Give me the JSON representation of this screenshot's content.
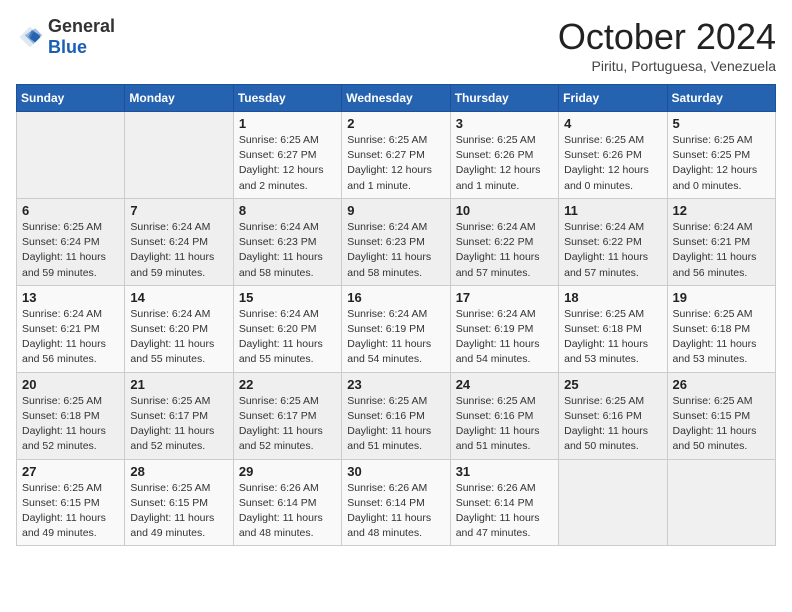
{
  "header": {
    "logo_general": "General",
    "logo_blue": "Blue",
    "month_title": "October 2024",
    "location": "Piritu, Portuguesa, Venezuela"
  },
  "weekdays": [
    "Sunday",
    "Monday",
    "Tuesday",
    "Wednesday",
    "Thursday",
    "Friday",
    "Saturday"
  ],
  "weeks": [
    [
      {
        "day": "",
        "sunrise": "",
        "sunset": "",
        "daylight": ""
      },
      {
        "day": "",
        "sunrise": "",
        "sunset": "",
        "daylight": ""
      },
      {
        "day": "1",
        "sunrise": "Sunrise: 6:25 AM",
        "sunset": "Sunset: 6:27 PM",
        "daylight": "Daylight: 12 hours and 2 minutes."
      },
      {
        "day": "2",
        "sunrise": "Sunrise: 6:25 AM",
        "sunset": "Sunset: 6:27 PM",
        "daylight": "Daylight: 12 hours and 1 minute."
      },
      {
        "day": "3",
        "sunrise": "Sunrise: 6:25 AM",
        "sunset": "Sunset: 6:26 PM",
        "daylight": "Daylight: 12 hours and 1 minute."
      },
      {
        "day": "4",
        "sunrise": "Sunrise: 6:25 AM",
        "sunset": "Sunset: 6:26 PM",
        "daylight": "Daylight: 12 hours and 0 minutes."
      },
      {
        "day": "5",
        "sunrise": "Sunrise: 6:25 AM",
        "sunset": "Sunset: 6:25 PM",
        "daylight": "Daylight: 12 hours and 0 minutes."
      }
    ],
    [
      {
        "day": "6",
        "sunrise": "Sunrise: 6:25 AM",
        "sunset": "Sunset: 6:24 PM",
        "daylight": "Daylight: 11 hours and 59 minutes."
      },
      {
        "day": "7",
        "sunrise": "Sunrise: 6:24 AM",
        "sunset": "Sunset: 6:24 PM",
        "daylight": "Daylight: 11 hours and 59 minutes."
      },
      {
        "day": "8",
        "sunrise": "Sunrise: 6:24 AM",
        "sunset": "Sunset: 6:23 PM",
        "daylight": "Daylight: 11 hours and 58 minutes."
      },
      {
        "day": "9",
        "sunrise": "Sunrise: 6:24 AM",
        "sunset": "Sunset: 6:23 PM",
        "daylight": "Daylight: 11 hours and 58 minutes."
      },
      {
        "day": "10",
        "sunrise": "Sunrise: 6:24 AM",
        "sunset": "Sunset: 6:22 PM",
        "daylight": "Daylight: 11 hours and 57 minutes."
      },
      {
        "day": "11",
        "sunrise": "Sunrise: 6:24 AM",
        "sunset": "Sunset: 6:22 PM",
        "daylight": "Daylight: 11 hours and 57 minutes."
      },
      {
        "day": "12",
        "sunrise": "Sunrise: 6:24 AM",
        "sunset": "Sunset: 6:21 PM",
        "daylight": "Daylight: 11 hours and 56 minutes."
      }
    ],
    [
      {
        "day": "13",
        "sunrise": "Sunrise: 6:24 AM",
        "sunset": "Sunset: 6:21 PM",
        "daylight": "Daylight: 11 hours and 56 minutes."
      },
      {
        "day": "14",
        "sunrise": "Sunrise: 6:24 AM",
        "sunset": "Sunset: 6:20 PM",
        "daylight": "Daylight: 11 hours and 55 minutes."
      },
      {
        "day": "15",
        "sunrise": "Sunrise: 6:24 AM",
        "sunset": "Sunset: 6:20 PM",
        "daylight": "Daylight: 11 hours and 55 minutes."
      },
      {
        "day": "16",
        "sunrise": "Sunrise: 6:24 AM",
        "sunset": "Sunset: 6:19 PM",
        "daylight": "Daylight: 11 hours and 54 minutes."
      },
      {
        "day": "17",
        "sunrise": "Sunrise: 6:24 AM",
        "sunset": "Sunset: 6:19 PM",
        "daylight": "Daylight: 11 hours and 54 minutes."
      },
      {
        "day": "18",
        "sunrise": "Sunrise: 6:25 AM",
        "sunset": "Sunset: 6:18 PM",
        "daylight": "Daylight: 11 hours and 53 minutes."
      },
      {
        "day": "19",
        "sunrise": "Sunrise: 6:25 AM",
        "sunset": "Sunset: 6:18 PM",
        "daylight": "Daylight: 11 hours and 53 minutes."
      }
    ],
    [
      {
        "day": "20",
        "sunrise": "Sunrise: 6:25 AM",
        "sunset": "Sunset: 6:18 PM",
        "daylight": "Daylight: 11 hours and 52 minutes."
      },
      {
        "day": "21",
        "sunrise": "Sunrise: 6:25 AM",
        "sunset": "Sunset: 6:17 PM",
        "daylight": "Daylight: 11 hours and 52 minutes."
      },
      {
        "day": "22",
        "sunrise": "Sunrise: 6:25 AM",
        "sunset": "Sunset: 6:17 PM",
        "daylight": "Daylight: 11 hours and 52 minutes."
      },
      {
        "day": "23",
        "sunrise": "Sunrise: 6:25 AM",
        "sunset": "Sunset: 6:16 PM",
        "daylight": "Daylight: 11 hours and 51 minutes."
      },
      {
        "day": "24",
        "sunrise": "Sunrise: 6:25 AM",
        "sunset": "Sunset: 6:16 PM",
        "daylight": "Daylight: 11 hours and 51 minutes."
      },
      {
        "day": "25",
        "sunrise": "Sunrise: 6:25 AM",
        "sunset": "Sunset: 6:16 PM",
        "daylight": "Daylight: 11 hours and 50 minutes."
      },
      {
        "day": "26",
        "sunrise": "Sunrise: 6:25 AM",
        "sunset": "Sunset: 6:15 PM",
        "daylight": "Daylight: 11 hours and 50 minutes."
      }
    ],
    [
      {
        "day": "27",
        "sunrise": "Sunrise: 6:25 AM",
        "sunset": "Sunset: 6:15 PM",
        "daylight": "Daylight: 11 hours and 49 minutes."
      },
      {
        "day": "28",
        "sunrise": "Sunrise: 6:25 AM",
        "sunset": "Sunset: 6:15 PM",
        "daylight": "Daylight: 11 hours and 49 minutes."
      },
      {
        "day": "29",
        "sunrise": "Sunrise: 6:26 AM",
        "sunset": "Sunset: 6:14 PM",
        "daylight": "Daylight: 11 hours and 48 minutes."
      },
      {
        "day": "30",
        "sunrise": "Sunrise: 6:26 AM",
        "sunset": "Sunset: 6:14 PM",
        "daylight": "Daylight: 11 hours and 48 minutes."
      },
      {
        "day": "31",
        "sunrise": "Sunrise: 6:26 AM",
        "sunset": "Sunset: 6:14 PM",
        "daylight": "Daylight: 11 hours and 47 minutes."
      },
      {
        "day": "",
        "sunrise": "",
        "sunset": "",
        "daylight": ""
      },
      {
        "day": "",
        "sunrise": "",
        "sunset": "",
        "daylight": ""
      }
    ]
  ]
}
